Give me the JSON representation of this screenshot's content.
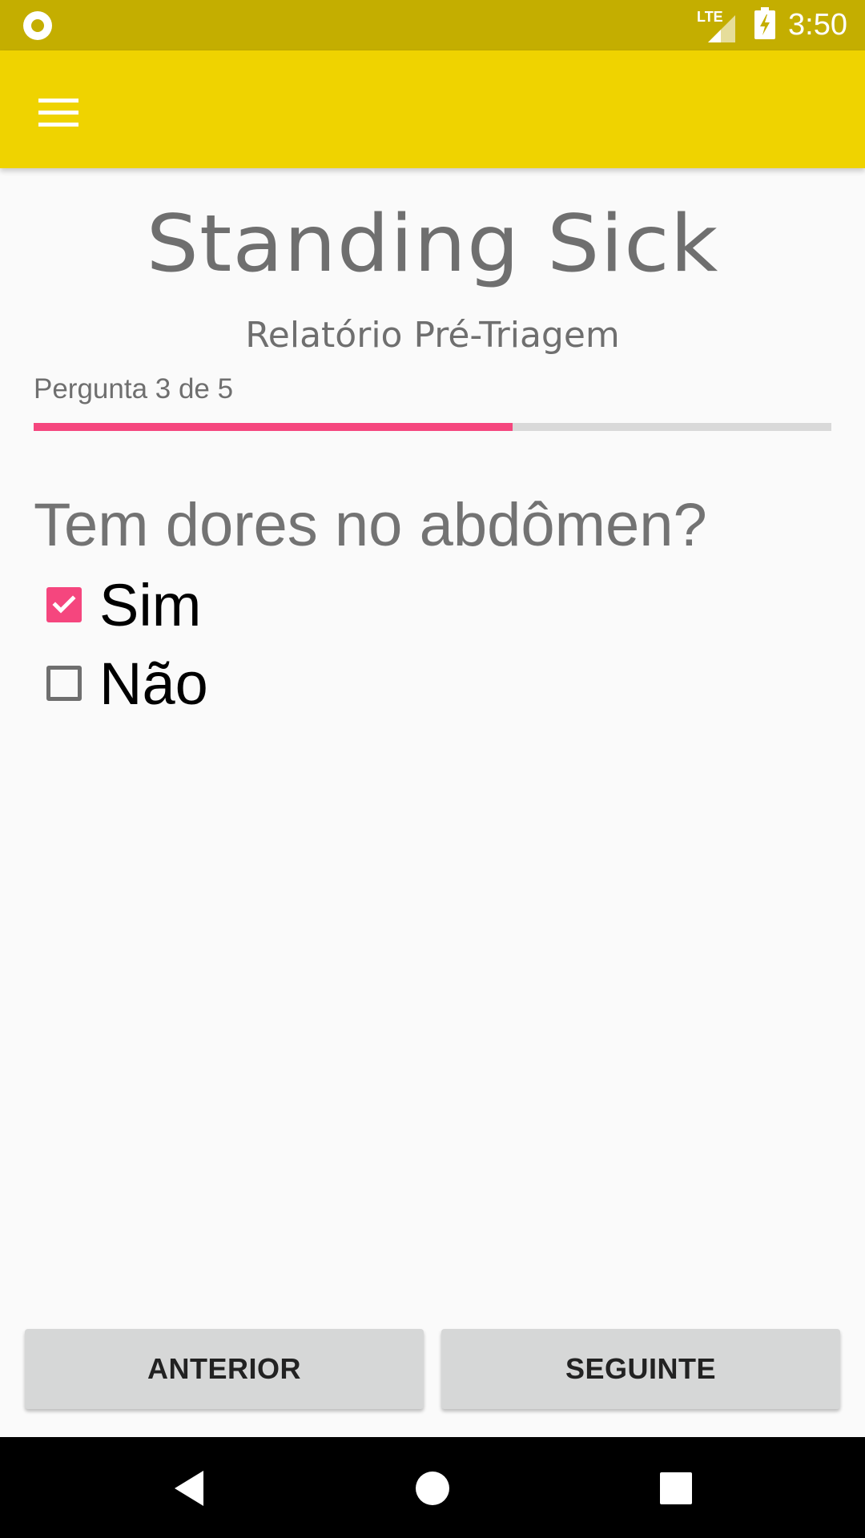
{
  "status_bar": {
    "time": "3:50",
    "network_label": "LTE",
    "icons": [
      "notification-circle-icon",
      "lte-signal-icon",
      "battery-charging-icon"
    ],
    "color": "#c4ae00"
  },
  "app_bar": {
    "color": "#efd300",
    "menu_icon": "hamburger-menu-icon"
  },
  "header": {
    "title": "Standing Sick",
    "subtitle": "Relatório Pré-Triagem"
  },
  "progress": {
    "label": "Pergunta 3 de 5",
    "current": 3,
    "total": 5,
    "fraction": 0.6,
    "fill_color": "#f5467e",
    "track_color": "#d9d9d9"
  },
  "question": {
    "text": "Tem dores no abdômen?",
    "options": [
      {
        "label": "Sim",
        "checked": true
      },
      {
        "label": "Não",
        "checked": false
      }
    ]
  },
  "buttons": {
    "previous": "ANTERIOR",
    "next": "SEGUINTE"
  },
  "nav_bar": {
    "icons": [
      "back-triangle-icon",
      "home-circle-icon",
      "recents-square-icon"
    ]
  }
}
